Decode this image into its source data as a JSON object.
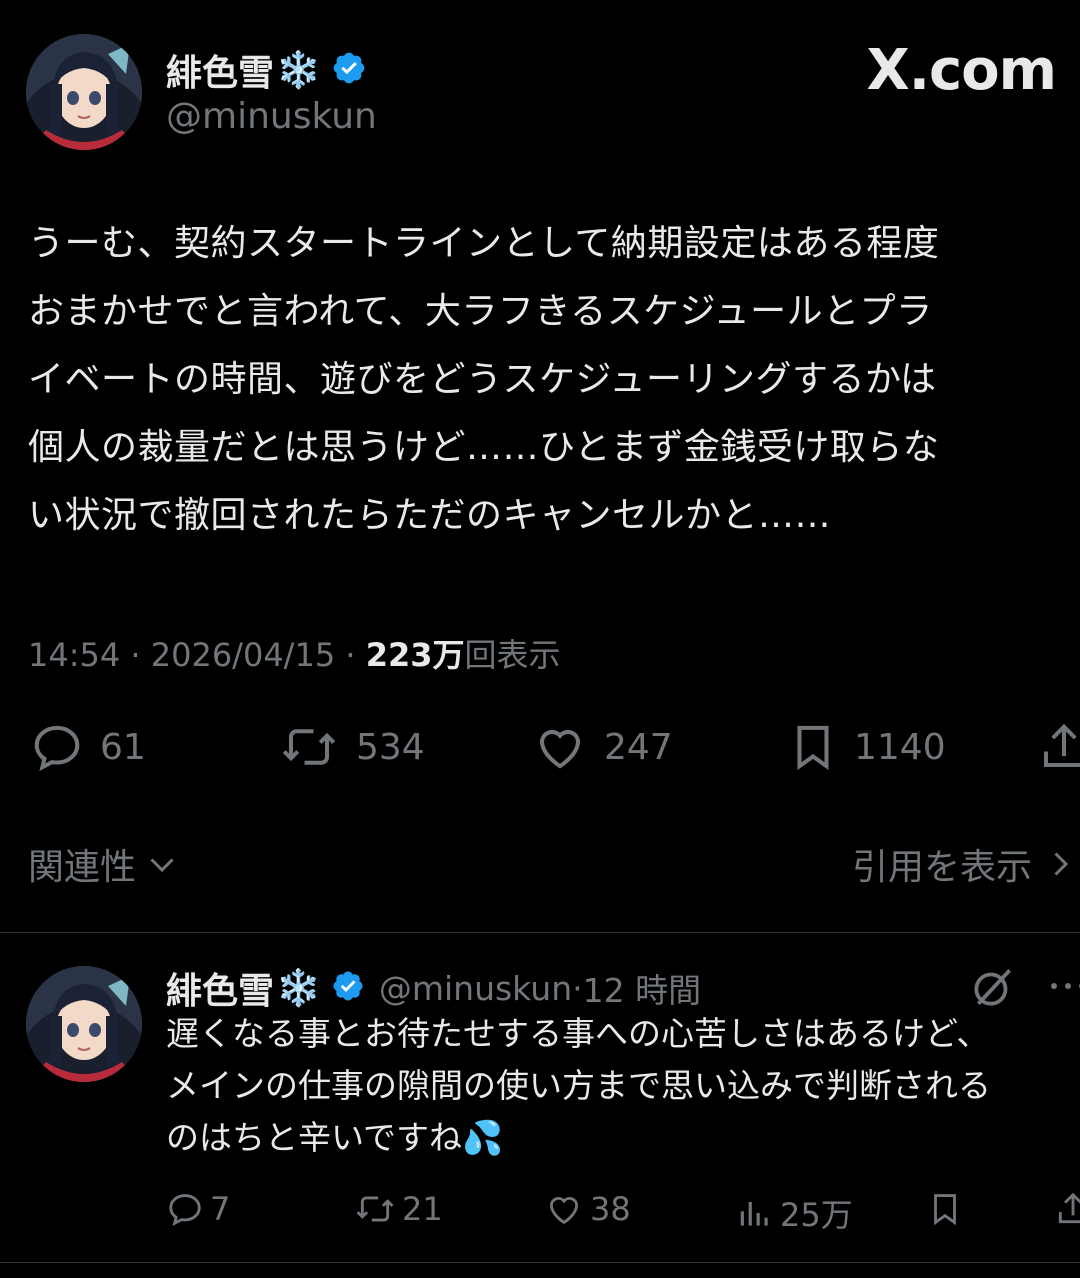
{
  "site_label": "X.com",
  "tweet": {
    "author_name": "緋色雪",
    "author_emoji": "❄️",
    "handle": "@minuskun",
    "text_lines": [
      "うーむ、契約スタートラインとして納期設定はある程度",
      "おまかせでと言われて、大ラフきるスケジュールとプラ",
      "イベートの時間、遊びをどうスケジューリングするかは",
      "個人の裁量だとは思うけど……ひとまず金銭受け取らな",
      "い状況で撤回されたらただのキャンセルかと……"
    ],
    "time": "14:54",
    "date": "2026/04/15",
    "views": "223万",
    "views_label": "回表示",
    "replies": "61",
    "reposts": "534",
    "likes": "247",
    "bookmarks": "1140"
  },
  "sort": {
    "label": "関連性"
  },
  "quotes": {
    "label": "引用を表示"
  },
  "reply": {
    "author_name": "緋色雪",
    "author_emoji": "❄️",
    "handle": "@minuskun",
    "time_ago": "12 時間",
    "text_lines": [
      "遅くなる事とお待たせする事への心苦しさはあるけど、",
      "メインの仕事の隙間の使い方まで思い込みで判断される",
      "のはちと辛いですね💦"
    ],
    "replies": "7",
    "reposts": "21",
    "likes": "38",
    "views": "25万"
  },
  "colors": {
    "verified": "#1d9bf0",
    "muted": "#71767b",
    "text": "#e7e9ea",
    "bg": "#000000"
  }
}
